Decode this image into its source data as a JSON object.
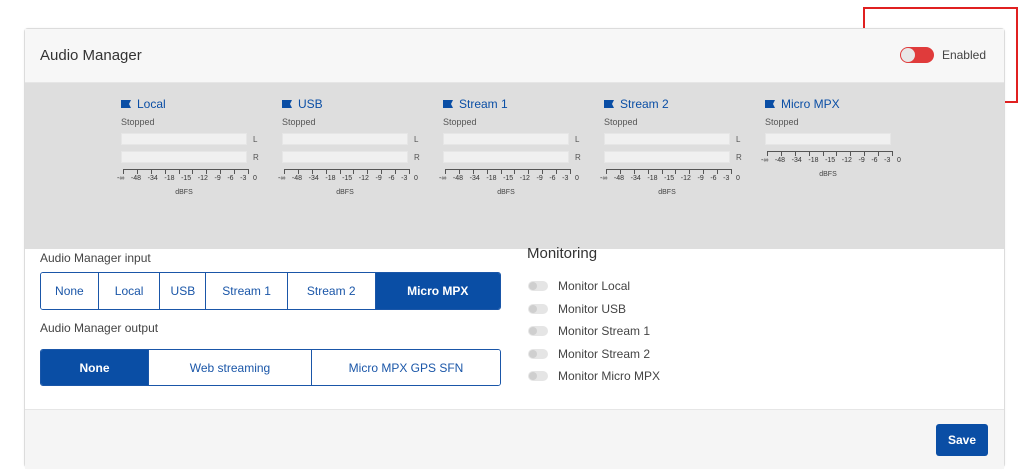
{
  "header": {
    "title": "Audio Manager",
    "toggle_label": "Enabled",
    "toggle_on": true
  },
  "colors": {
    "accent": "#0a4ea5",
    "toggle_on": "#e03b3b",
    "highlight": "#e02020"
  },
  "meters": [
    {
      "name": "Local",
      "status": "Stopped",
      "channels": [
        "L",
        "R"
      ],
      "unit": "dBFS"
    },
    {
      "name": "USB",
      "status": "Stopped",
      "channels": [
        "L",
        "R"
      ],
      "unit": "dBFS"
    },
    {
      "name": "Stream 1",
      "status": "Stopped",
      "channels": [
        "L",
        "R"
      ],
      "unit": "dBFS"
    },
    {
      "name": "Stream 2",
      "status": "Stopped",
      "channels": [
        "L",
        "R"
      ],
      "unit": "dBFS"
    },
    {
      "name": "Micro MPX",
      "status": "Stopped",
      "channels": [],
      "unit": "dBFS"
    }
  ],
  "scale_labels": [
    "-∞",
    "-48",
    "-34",
    "-18",
    "-15",
    "-12",
    "-9",
    "-6",
    "-3",
    "0"
  ],
  "input": {
    "label": "Audio Manager input",
    "options": [
      "None",
      "Local",
      "USB",
      "Stream 1",
      "Stream 2",
      "Micro MPX"
    ],
    "selected": "Micro MPX"
  },
  "output": {
    "label": "Audio Manager output",
    "options": [
      "None",
      "Web streaming",
      "Micro MPX GPS SFN"
    ],
    "selected": "None"
  },
  "monitoring": {
    "title": "Monitoring",
    "items": [
      "Monitor Local",
      "Monitor USB",
      "Monitor Stream 1",
      "Monitor Stream 2",
      "Monitor Micro MPX"
    ]
  },
  "footer": {
    "save_label": "Save"
  }
}
